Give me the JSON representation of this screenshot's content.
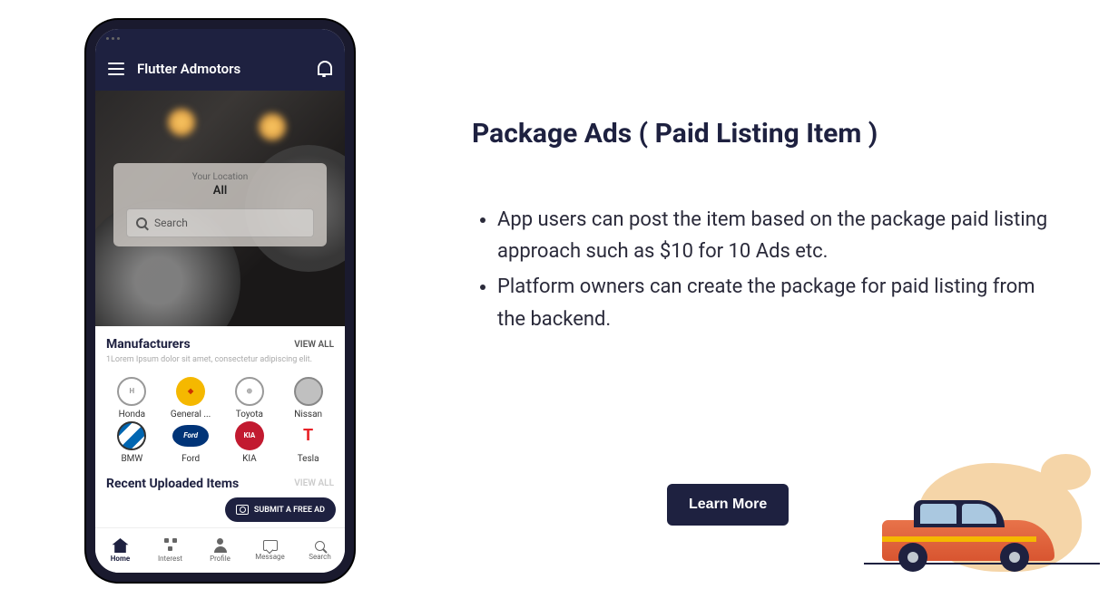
{
  "app": {
    "title": "Flutter Admotors"
  },
  "hero": {
    "location_label": "Your Location",
    "location_value": "All",
    "search_placeholder": "Search"
  },
  "manufacturers": {
    "title": "Manufacturers",
    "view_all": "VIEW ALL",
    "subtitle": "1Lorem Ipsum dolor sit amet, consectetur adipiscing elit.",
    "brands": [
      {
        "name": "Honda"
      },
      {
        "name": "General ..."
      },
      {
        "name": "Toyota"
      },
      {
        "name": "Nissan"
      },
      {
        "name": "BMW"
      },
      {
        "name": "Ford"
      },
      {
        "name": "KIA"
      },
      {
        "name": "Tesla"
      }
    ]
  },
  "recent": {
    "title": "Recent Uploaded Items",
    "view_all": "VIEW ALL"
  },
  "fab": {
    "label": "SUBMIT A FREE AD"
  },
  "nav": {
    "items": [
      {
        "label": "Home"
      },
      {
        "label": "Interest"
      },
      {
        "label": "Profile"
      },
      {
        "label": "Message"
      },
      {
        "label": "Search"
      }
    ]
  },
  "page": {
    "title": "Package Ads ( Paid Listing Item )",
    "bullets": [
      "App users can post the item based on the package paid listing approach such as $10 for 10 Ads etc.",
      "Platform owners can create the package for paid listing from the backend."
    ],
    "learn_more": "Learn More"
  }
}
